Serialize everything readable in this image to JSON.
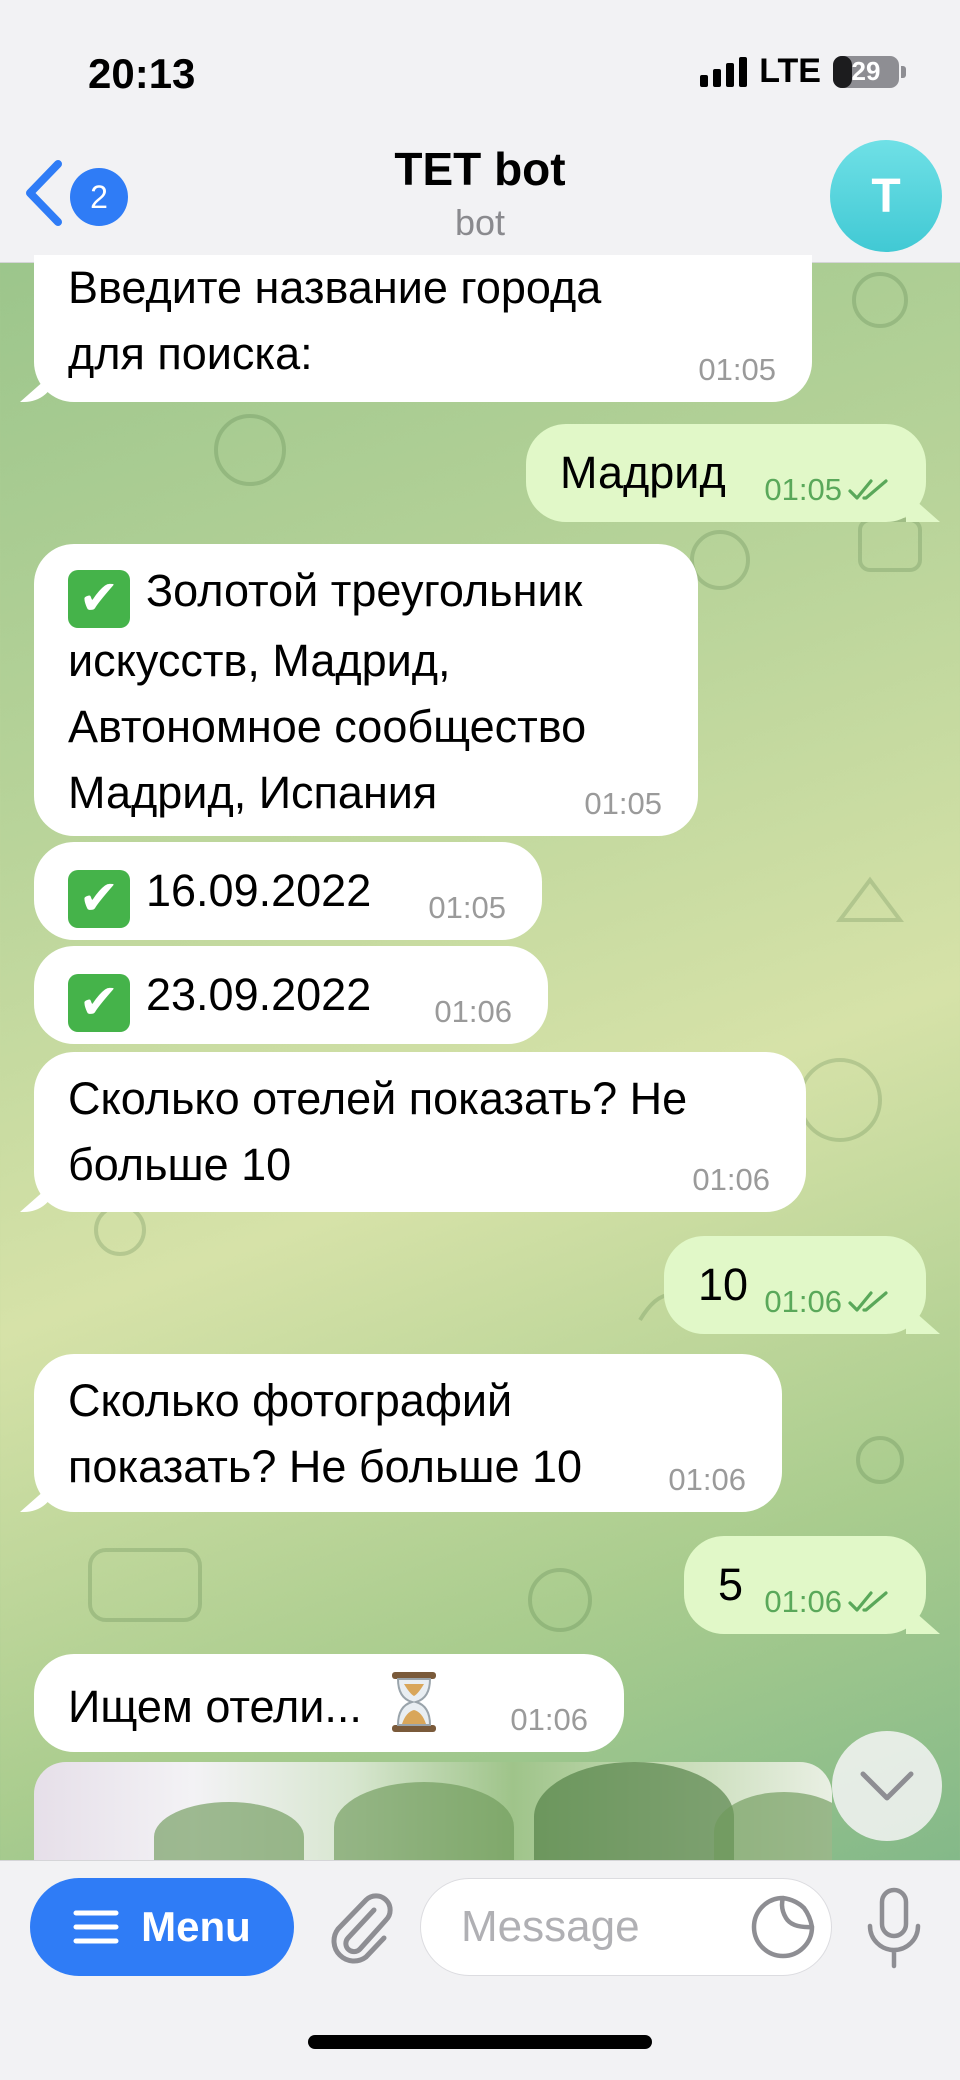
{
  "status_bar": {
    "time": "20:13",
    "network": "LTE",
    "battery": "29",
    "battery_level": 0.29
  },
  "header": {
    "back_badge": "2",
    "title": "TET bot",
    "subtitle": "bot",
    "avatar_letter": "T"
  },
  "messages": [
    {
      "side": "in",
      "text": "Введите название города для поиска:",
      "time": "01:05"
    },
    {
      "side": "out",
      "text": "Мадрид",
      "time": "01:05",
      "read": true
    },
    {
      "side": "in",
      "emoji": "✔",
      "text": "Золотой треугольник искусств, Мадрид, Автономное сообщество Мадрид, Испания",
      "time": "01:05"
    },
    {
      "side": "in",
      "emoji": "✔",
      "text": "16.09.2022",
      "time": "01:05"
    },
    {
      "side": "in",
      "emoji": "✔",
      "text": "23.09.2022",
      "time": "01:06"
    },
    {
      "side": "in",
      "text": "Сколько отелей показать? Не больше 10",
      "time": "01:06"
    },
    {
      "side": "out",
      "text": "10",
      "time": "01:06",
      "read": true
    },
    {
      "side": "in",
      "text": "Сколько фотографий показать? Не больше 10",
      "time": "01:06"
    },
    {
      "side": "out",
      "text": "5",
      "time": "01:06",
      "read": true
    },
    {
      "side": "in",
      "text": "Ищем отели...",
      "time": "01:06"
    }
  ],
  "bottom_bar": {
    "menu_label": "Menu",
    "input_placeholder": "Message"
  },
  "icons": {
    "back": "chevron-left-icon",
    "attach": "paperclip-icon",
    "sticker": "sticker-icon",
    "mic": "microphone-icon",
    "scroll": "chevron-down-icon",
    "hourglass": "hourglass-icon"
  },
  "colors": {
    "accent": "#2f7cf6",
    "outgoing_bubble": "#e1f8c8",
    "incoming_bubble": "#ffffff",
    "read_check": "#5aa85a"
  }
}
